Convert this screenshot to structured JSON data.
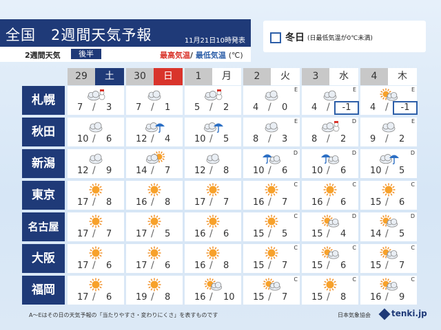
{
  "header": {
    "title": "全国　2週間天気予報",
    "issued": "11月21日10時発表",
    "sub_label": "2週間天気",
    "half": "後半",
    "legend_hi": "最高気温",
    "legend_sep": "/",
    "legend_lo": "最低気温",
    "legend_unit": "(℃)"
  },
  "winter_legend": {
    "label": "冬日",
    "note": "(日最低気温が0℃未満)"
  },
  "colors": {
    "navy": "#1f3a78",
    "saturday": "#1f3a78",
    "sunday": "#d9342b",
    "weekday": "#ffffff",
    "accent_blue": "#2c5ea8",
    "red": "#d9342b"
  },
  "days": [
    {
      "date": "29",
      "dow": "土",
      "type": "saturday"
    },
    {
      "date": "30",
      "dow": "日",
      "type": "sunday"
    },
    {
      "date": "1",
      "dow": "月",
      "type": "weekday"
    },
    {
      "date": "2",
      "dow": "火",
      "type": "weekday"
    },
    {
      "date": "3",
      "dow": "水",
      "type": "weekday"
    },
    {
      "date": "4",
      "dow": "木",
      "type": "weekday"
    }
  ],
  "cities": [
    {
      "name": "札幌",
      "cells": [
        {
          "icon": "cloud-snow-icon",
          "hi": "7",
          "lo": "3",
          "rank": ""
        },
        {
          "icon": "cloud-icon",
          "hi": "7",
          "lo": "1",
          "rank": ""
        },
        {
          "icon": "cloud-snow-icon",
          "hi": "5",
          "lo": "2",
          "rank": ""
        },
        {
          "icon": "cloud-icon",
          "hi": "4",
          "lo": "0",
          "rank": "E"
        },
        {
          "icon": "cloud-icon",
          "hi": "4",
          "lo": "-1",
          "rank": "E",
          "frost": true
        },
        {
          "icon": "sun-cloud-icon",
          "hi": "4",
          "lo": "-1",
          "rank": "E",
          "frost": true
        }
      ]
    },
    {
      "name": "秋田",
      "cells": [
        {
          "icon": "cloud-icon",
          "hi": "10",
          "lo": "6",
          "rank": ""
        },
        {
          "icon": "cloud-umbrella-icon",
          "hi": "12",
          "lo": "4",
          "rank": ""
        },
        {
          "icon": "cloud-umbrella-icon",
          "hi": "10",
          "lo": "5",
          "rank": ""
        },
        {
          "icon": "cloud-icon",
          "hi": "8",
          "lo": "3",
          "rank": "E"
        },
        {
          "icon": "cloud-snow-icon",
          "hi": "8",
          "lo": "2",
          "rank": "D"
        },
        {
          "icon": "cloud-icon",
          "hi": "9",
          "lo": "2",
          "rank": "E"
        }
      ]
    },
    {
      "name": "新潟",
      "cells": [
        {
          "icon": "cloud-icon",
          "hi": "12",
          "lo": "9",
          "rank": ""
        },
        {
          "icon": "cloud-sun-icon",
          "hi": "14",
          "lo": "7",
          "rank": ""
        },
        {
          "icon": "cloud-icon",
          "hi": "12",
          "lo": "8",
          "rank": ""
        },
        {
          "icon": "umbrella-cloud-icon",
          "hi": "10",
          "lo": "6",
          "rank": "D"
        },
        {
          "icon": "umbrella-cloud-icon",
          "hi": "10",
          "lo": "6",
          "rank": "D"
        },
        {
          "icon": "cloud-umbrella-icon",
          "hi": "10",
          "lo": "5",
          "rank": "D"
        }
      ]
    },
    {
      "name": "東京",
      "cells": [
        {
          "icon": "sun-icon",
          "hi": "17",
          "lo": "8",
          "rank": ""
        },
        {
          "icon": "sun-icon",
          "hi": "16",
          "lo": "8",
          "rank": ""
        },
        {
          "icon": "sun-icon",
          "hi": "17",
          "lo": "7",
          "rank": ""
        },
        {
          "icon": "sun-icon",
          "hi": "16",
          "lo": "7",
          "rank": "C"
        },
        {
          "icon": "sun-icon",
          "hi": "16",
          "lo": "6",
          "rank": "C"
        },
        {
          "icon": "sun-icon",
          "hi": "15",
          "lo": "6",
          "rank": "C"
        }
      ]
    },
    {
      "name": "名古屋",
      "cells": [
        {
          "icon": "sun-icon",
          "hi": "17",
          "lo": "7",
          "rank": ""
        },
        {
          "icon": "sun-icon",
          "hi": "17",
          "lo": "5",
          "rank": ""
        },
        {
          "icon": "sun-icon",
          "hi": "16",
          "lo": "6",
          "rank": ""
        },
        {
          "icon": "sun-icon",
          "hi": "15",
          "lo": "5",
          "rank": "C"
        },
        {
          "icon": "sun-cloud-icon",
          "hi": "15",
          "lo": "4",
          "rank": "D"
        },
        {
          "icon": "sun-cloud-icon",
          "hi": "14",
          "lo": "5",
          "rank": "D"
        }
      ]
    },
    {
      "name": "大阪",
      "cells": [
        {
          "icon": "sun-icon",
          "hi": "17",
          "lo": "6",
          "rank": ""
        },
        {
          "icon": "sun-icon",
          "hi": "17",
          "lo": "6",
          "rank": ""
        },
        {
          "icon": "sun-icon",
          "hi": "16",
          "lo": "8",
          "rank": ""
        },
        {
          "icon": "sun-icon",
          "hi": "15",
          "lo": "7",
          "rank": "C"
        },
        {
          "icon": "sun-cloud-icon",
          "hi": "15",
          "lo": "6",
          "rank": "C"
        },
        {
          "icon": "sun-cloud-icon",
          "hi": "15",
          "lo": "7",
          "rank": "C"
        }
      ]
    },
    {
      "name": "福岡",
      "cells": [
        {
          "icon": "sun-icon",
          "hi": "17",
          "lo": "6",
          "rank": ""
        },
        {
          "icon": "sun-icon",
          "hi": "19",
          "lo": "8",
          "rank": ""
        },
        {
          "icon": "sun-cloud-icon",
          "hi": "16",
          "lo": "10",
          "rank": ""
        },
        {
          "icon": "sun-cloud-icon",
          "hi": "15",
          "lo": "7",
          "rank": "C"
        },
        {
          "icon": "sun-icon",
          "hi": "15",
          "lo": "8",
          "rank": "C"
        },
        {
          "icon": "sun-cloud-icon",
          "hi": "16",
          "lo": "9",
          "rank": "C"
        }
      ]
    }
  ],
  "footer": {
    "note": "A〜Eはその日の天気予報の「当たりやすさ・変わりにくさ」を表すものです",
    "jma": "日本気象協会",
    "brand": "tenki.jp"
  }
}
